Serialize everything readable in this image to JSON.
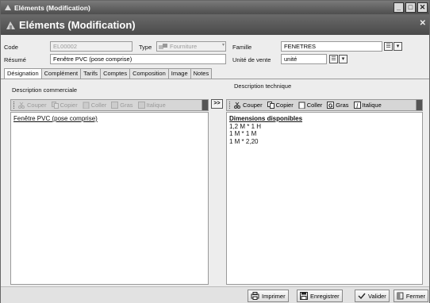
{
  "window": {
    "title": "Eléments (Modification)",
    "header": "Eléments (Modification)"
  },
  "colors": {
    "titlebar": "#5a5a5a",
    "header": "#555555"
  },
  "form": {
    "code_label": "Code",
    "code_value": "EL00002",
    "type_label": "Type",
    "type_value": "Fourniture",
    "famille_label": "Famille",
    "famille_value": "FENETRES",
    "resume_label": "Résumé",
    "resume_value": "Fenêtre PVC (pose comprise)",
    "unite_label": "Unité de vente",
    "unite_value": "unité"
  },
  "tabs": [
    "Désignation",
    "Complément",
    "Tarifs",
    "Comptes",
    "Composition",
    "Image",
    "Notes"
  ],
  "left_panel": {
    "title": "Description commerciale",
    "toolbar": {
      "cut": "Couper",
      "copy": "Copier",
      "paste": "Coller",
      "bold": "Gras",
      "italic": "Italique"
    },
    "text": "Fenêtre PVC (pose comprise)"
  },
  "copy_button": ">>",
  "right_panel": {
    "title": "Description technique",
    "toolbar": {
      "cut": "Couper",
      "copy": "Copier",
      "paste": "Coller",
      "bold": "Gras",
      "italic": "Italique"
    },
    "heading": "Dimensions disponibles",
    "lines": [
      "1,2 M * 1 H",
      "1 M * 1 M",
      "1 M * 2,20"
    ]
  },
  "footer": {
    "print": "Imprimer",
    "save": "Enregistrer",
    "validate": "Valider",
    "close": "Fermer"
  }
}
